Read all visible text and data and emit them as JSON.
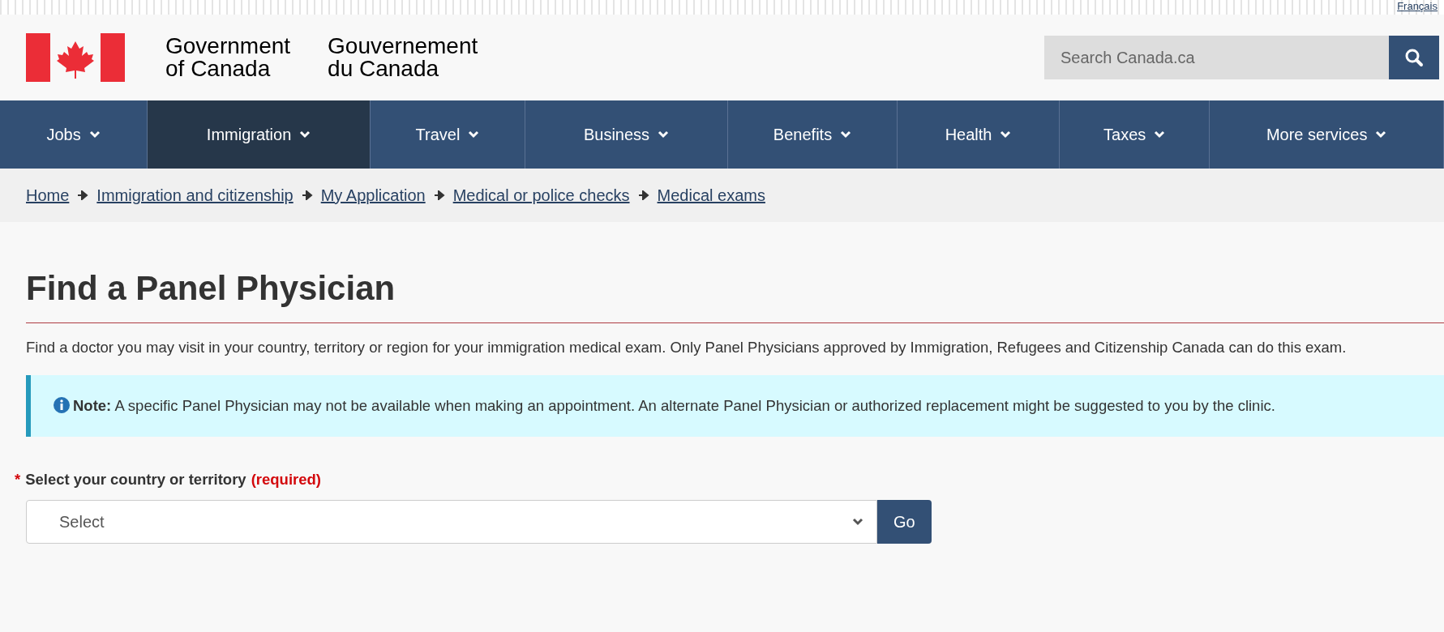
{
  "language_link": "Français",
  "header": {
    "wordmark_en": [
      "Government",
      "of Canada"
    ],
    "wordmark_fr": [
      "Gouvernement",
      "du Canada"
    ]
  },
  "search": {
    "placeholder": "Search Canada.ca"
  },
  "nav": [
    {
      "label": "Jobs",
      "selected": false
    },
    {
      "label": "Immigration",
      "selected": true
    },
    {
      "label": "Travel",
      "selected": false
    },
    {
      "label": "Business",
      "selected": false
    },
    {
      "label": "Benefits",
      "selected": false
    },
    {
      "label": "Health",
      "selected": false
    },
    {
      "label": "Taxes",
      "selected": false
    },
    {
      "label": "More services",
      "selected": false
    }
  ],
  "breadcrumb": [
    "Home",
    "Immigration and citizenship",
    "My Application",
    "Medical or police checks",
    "Medical exams"
  ],
  "title": "Find a Panel Physician",
  "intro": "Find a doctor you may visit in your country, territory or region for your immigration medical exam. Only Panel Physicians approved by Immigration, Refugees and Citizenship Canada can do this exam.",
  "note": "**Note:** A specific Panel Physician may not be available when making an appointment. An alternate Panel Physician or authorized replacement might be suggested to you by the clinic.",
  "form": {
    "required_mark": "*",
    "label": "Select your country or territory",
    "required_text": "(required)",
    "select_value": "Select",
    "button": "Go"
  }
}
